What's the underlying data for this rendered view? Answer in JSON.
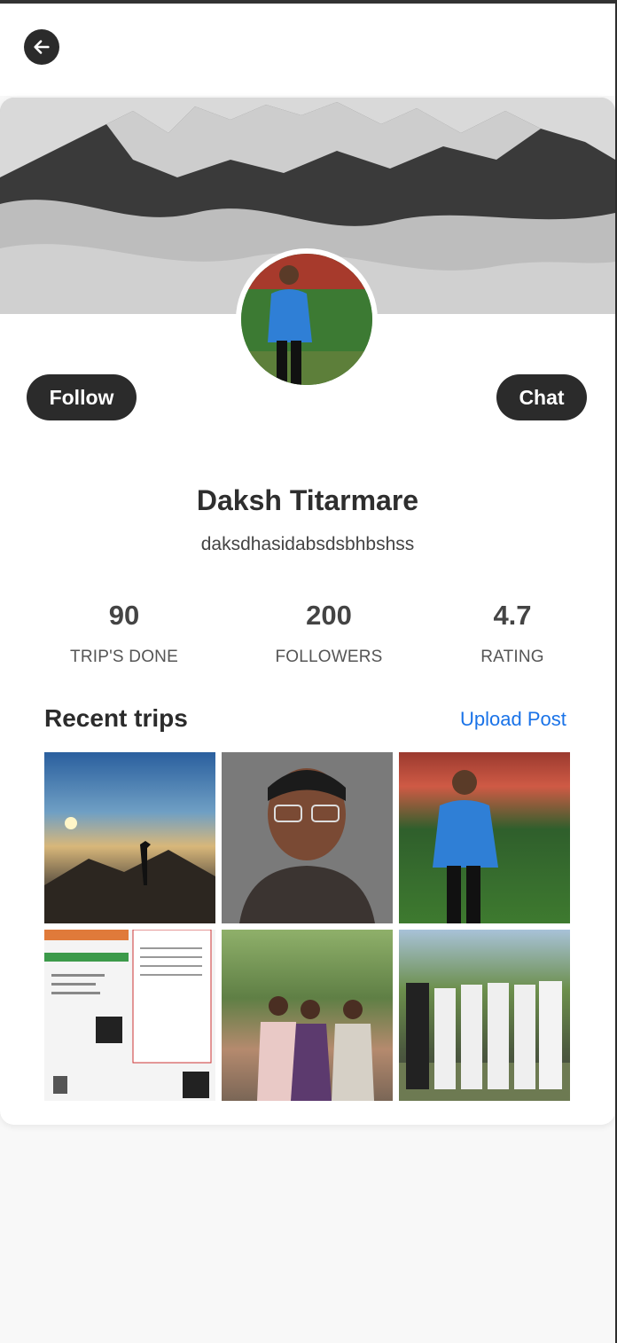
{
  "profile": {
    "name": "Daksh Titarmare",
    "handle": "daksdhasidabsdsbhbshss",
    "follow_label": "Follow",
    "chat_label": "Chat"
  },
  "stats": [
    {
      "value": "90",
      "label": "TRIP'S DONE"
    },
    {
      "value": "200",
      "label": "FOLLOWERS"
    },
    {
      "value": "4.7",
      "label": "RATING"
    }
  ],
  "recent": {
    "title": "Recent trips",
    "upload_label": "Upload Post"
  },
  "icons": {
    "back": "arrow-left-icon"
  },
  "colors": {
    "dark": "#2b2b2b",
    "link": "#1a73e8"
  }
}
